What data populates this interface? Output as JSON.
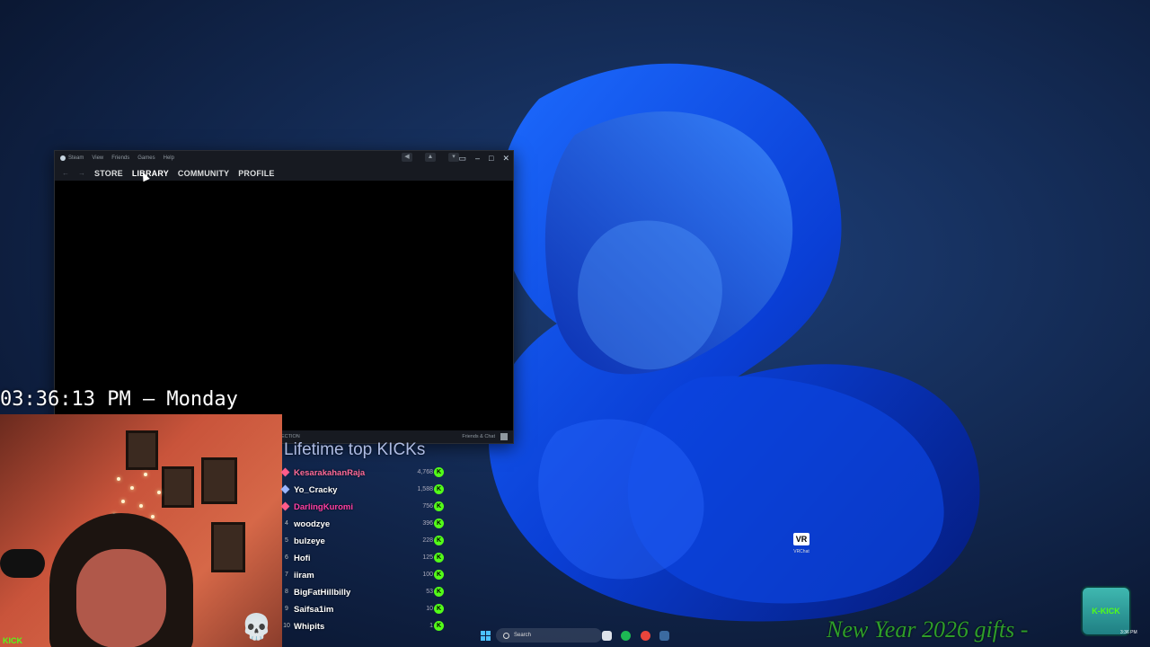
{
  "steam": {
    "menu": [
      "Steam",
      "View",
      "Friends",
      "Games",
      "Help"
    ],
    "nav": {
      "back": "←",
      "forward": "→",
      "links": [
        "STORE",
        "LIBRARY",
        "COMMUNITY",
        "PROFILE"
      ]
    },
    "window_controls": {
      "minimize": "–",
      "maximize": "□",
      "close": "✕"
    },
    "bottom": {
      "collection": "ECTION",
      "friends_chat": "Friends & Chat"
    }
  },
  "clock": {
    "text": "03:36:13 PM – Monday"
  },
  "overlay": {
    "kick_watermark": "KICK"
  },
  "leaderboard": {
    "title": "Lifetime top KICKs",
    "rows": [
      {
        "rank": "1",
        "name": "KesarakahanRaja",
        "amount": "4,768",
        "color": "#ff6b9a"
      },
      {
        "rank": "2",
        "name": "Yo_Cracky",
        "amount": "1,588",
        "color": "#ffffff"
      },
      {
        "rank": "3",
        "name": "DarlingKuromi",
        "amount": "756",
        "color": "#ff3fa4"
      },
      {
        "rank": "4",
        "name": "woodzye",
        "amount": "396",
        "color": "#ffffff"
      },
      {
        "rank": "5",
        "name": "bulzeye",
        "amount": "228",
        "color": "#ffffff"
      },
      {
        "rank": "6",
        "name": "Hofi",
        "amount": "125",
        "color": "#ffffff"
      },
      {
        "rank": "7",
        "name": "iiram",
        "amount": "100",
        "color": "#ffffff"
      },
      {
        "rank": "8",
        "name": "BigFatHillbilly",
        "amount": "53",
        "color": "#ffffff"
      },
      {
        "rank": "9",
        "name": "Saifsa1im",
        "amount": "10",
        "color": "#ffffff"
      },
      {
        "rank": "10",
        "name": "Whipits",
        "amount": "1",
        "color": "#ffffff"
      }
    ],
    "coin_glyph": "K"
  },
  "desktop_icon": {
    "badge": "VR",
    "label": "VRChat"
  },
  "taskbar": {
    "search_placeholder": "Search",
    "time": "3:36 PM"
  },
  "gifts_banner": "New Year 2026 gifts -",
  "kick_box": "K-KICK"
}
